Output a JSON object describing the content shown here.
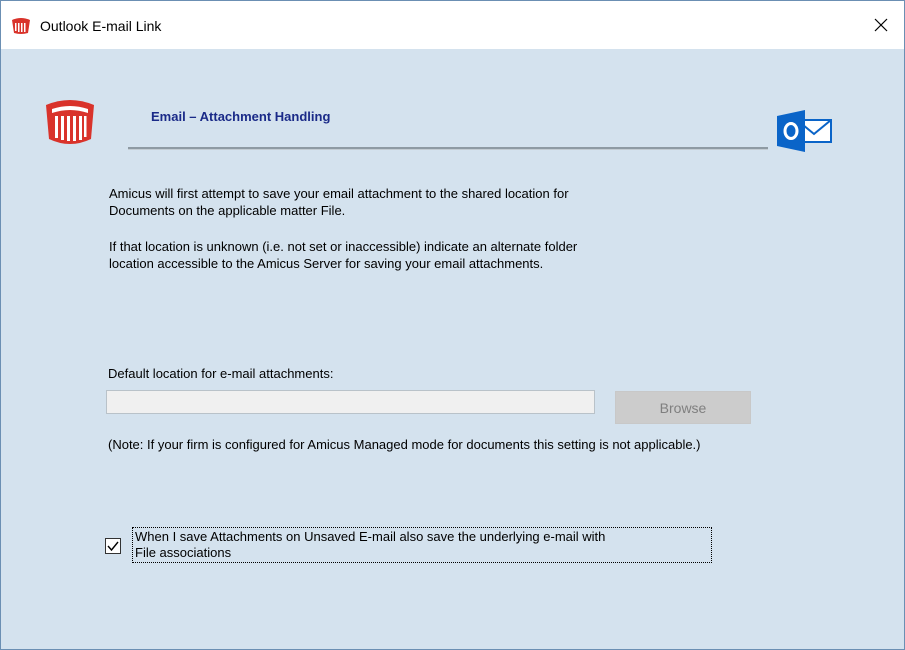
{
  "window": {
    "title": "Outlook E-mail Link",
    "close_glyph": "✕"
  },
  "header": {
    "title": "Email – Attachment Handling",
    "logo_icon": "amicus-logo-icon",
    "outlook_icon": "outlook-icon"
  },
  "body": {
    "paragraph1_line1": "Amicus will first attempt to save your email attachment to the shared location for",
    "paragraph1_line2": "Documents on the applicable matter File.",
    "paragraph2_line1": "If that location is unknown (i.e. not set or inaccessible) indicate an alternate folder",
    "paragraph2_line2": "location accessible to the Amicus Server for saving your email attachments."
  },
  "attachments": {
    "label": "Default location for e-mail attachments:",
    "path_value": "",
    "browse_label": "Browse",
    "note": "(Note:  If your firm is configured for Amicus Managed mode for documents this setting is not applicable.)"
  },
  "option": {
    "checked": true,
    "label_line1": "When I save Attachments on Unsaved E-mail also save the underlying e-mail with",
    "label_line2": "File associations"
  },
  "colors": {
    "background": "#d4e2ee",
    "accent_red": "#d9332b",
    "header_title": "#1a2a88",
    "outlook_blue": "#0a64c8"
  }
}
